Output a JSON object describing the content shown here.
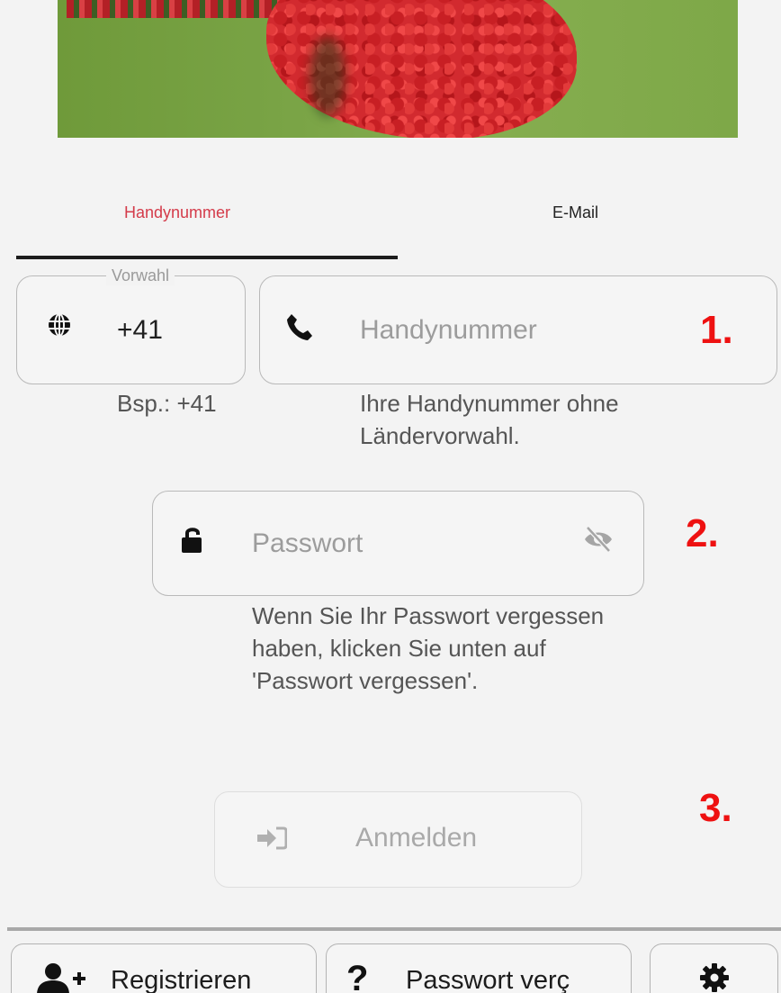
{
  "tabs": {
    "phone_label": "Handynummer",
    "email_label": "E-Mail",
    "active": "Handynummer"
  },
  "vorwahl": {
    "legend": "Vorwahl",
    "value": "+41",
    "hint": "Bsp.: +41"
  },
  "phone": {
    "placeholder": "Handynummer",
    "hint": "Ihre Handynummer ohne Ländervorwahl."
  },
  "password": {
    "placeholder": "Passwort",
    "hint": "Wenn Sie Ihr Passwort vergessen haben, klicken Sie unten auf 'Passwort vergessen'."
  },
  "login": {
    "label": "Anmelden"
  },
  "annotations": [
    "1.",
    "2.",
    "3."
  ],
  "bottom_bar": {
    "register_label": "Registrieren",
    "forgot_label": "Passwort verç",
    "help_glyph": "?"
  },
  "colors": {
    "accent": "#d43b4a",
    "annotation": "#ee1111",
    "background": "#f3f3f3"
  },
  "icons": [
    "globe-icon",
    "phone-icon",
    "lock-open-icon",
    "eye-off-icon",
    "sign-in-icon",
    "user-plus-icon",
    "question-icon",
    "gear-icon"
  ]
}
